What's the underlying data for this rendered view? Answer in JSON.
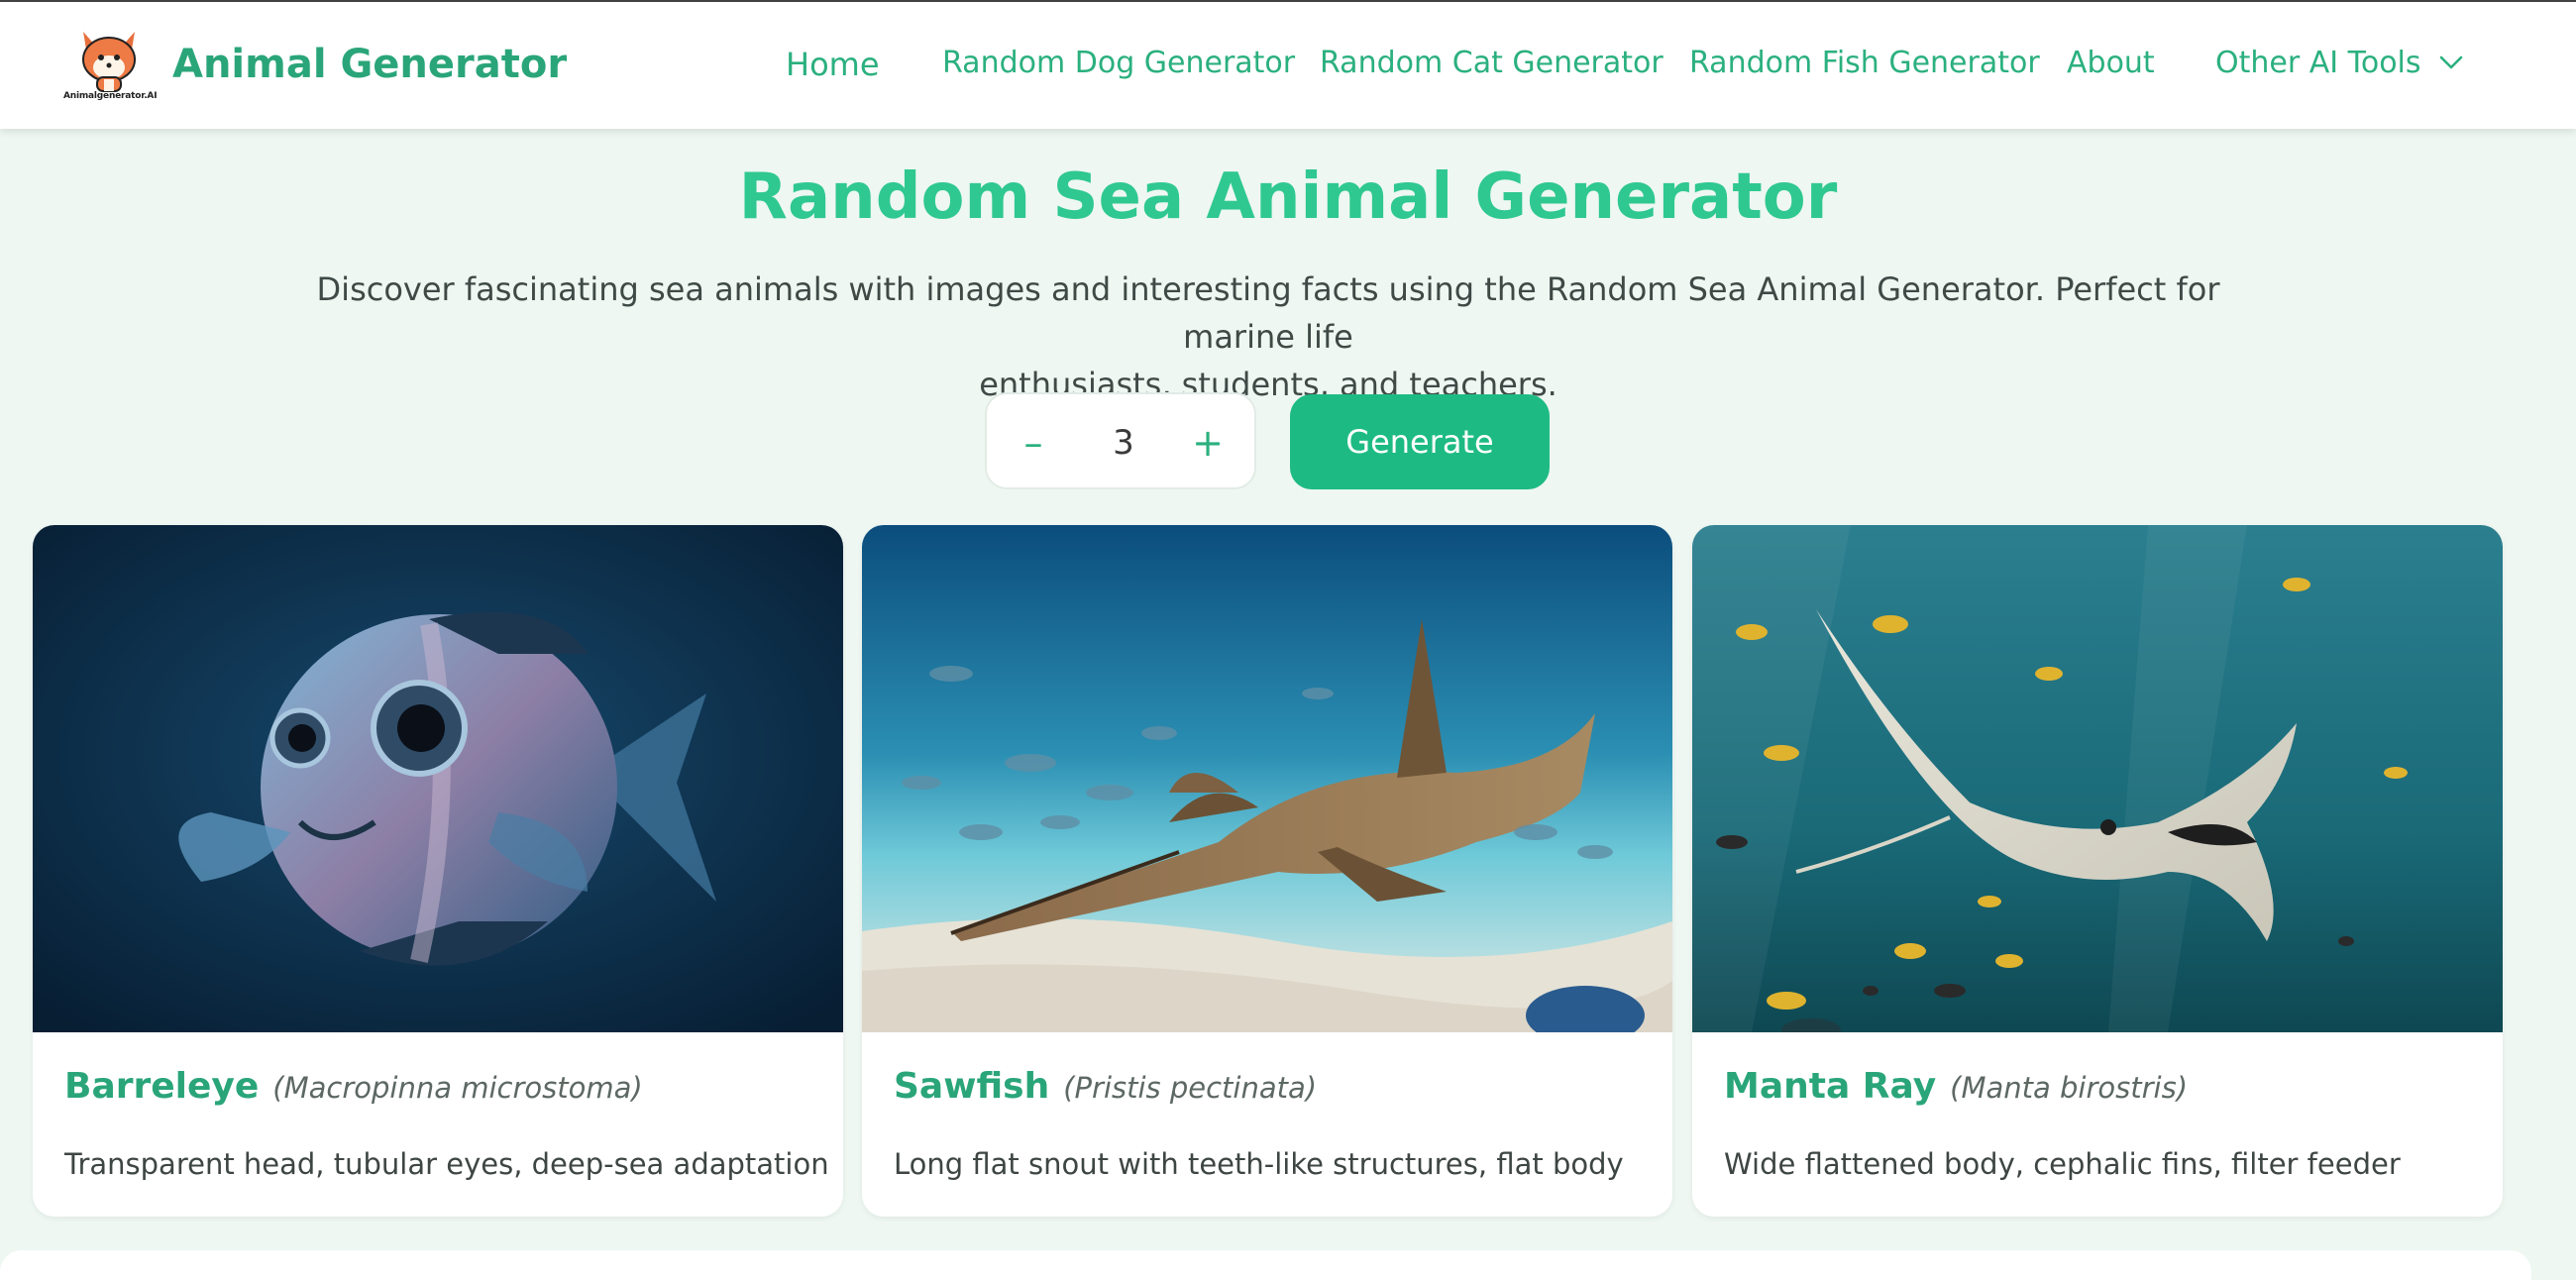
{
  "header": {
    "logo_caption": "Animalgenerator.AI",
    "brand": "Animal Generator",
    "nav": [
      {
        "label": "Home"
      },
      {
        "label": "Random Dog Generator"
      },
      {
        "label": "Random Cat Generator"
      },
      {
        "label": "Random Fish Generator"
      },
      {
        "label": "About"
      },
      {
        "label": "Other AI Tools",
        "icon": "chevron-down-icon"
      }
    ]
  },
  "main": {
    "title": "Random Sea Animal Generator",
    "intro_line1": "Discover fascinating sea animals with images and interesting facts using the Random Sea Animal Generator. Perfect for marine life",
    "intro_line2": "enthusiasts, students, and teachers.",
    "stepper": {
      "minus": "–",
      "value": "3",
      "plus": "+"
    },
    "generate_label": "Generate"
  },
  "cards": [
    {
      "name": "Barreleye",
      "scientific": "(Macropinna microstoma)",
      "description": "Transparent head, tubular eyes, deep-sea adaptation"
    },
    {
      "name": "Sawfish",
      "scientific": "(Pristis pectinata)",
      "description": "Long flat snout with teeth-like structures, flat body"
    },
    {
      "name": "Manta Ray",
      "scientific": "(Manta birostris)",
      "description": "Wide flattened body, cephalic fins, filter feeder"
    }
  ],
  "colors": {
    "accent": "#1dbb83",
    "title": "#2fc890",
    "page_bg": "#eef7f2"
  }
}
